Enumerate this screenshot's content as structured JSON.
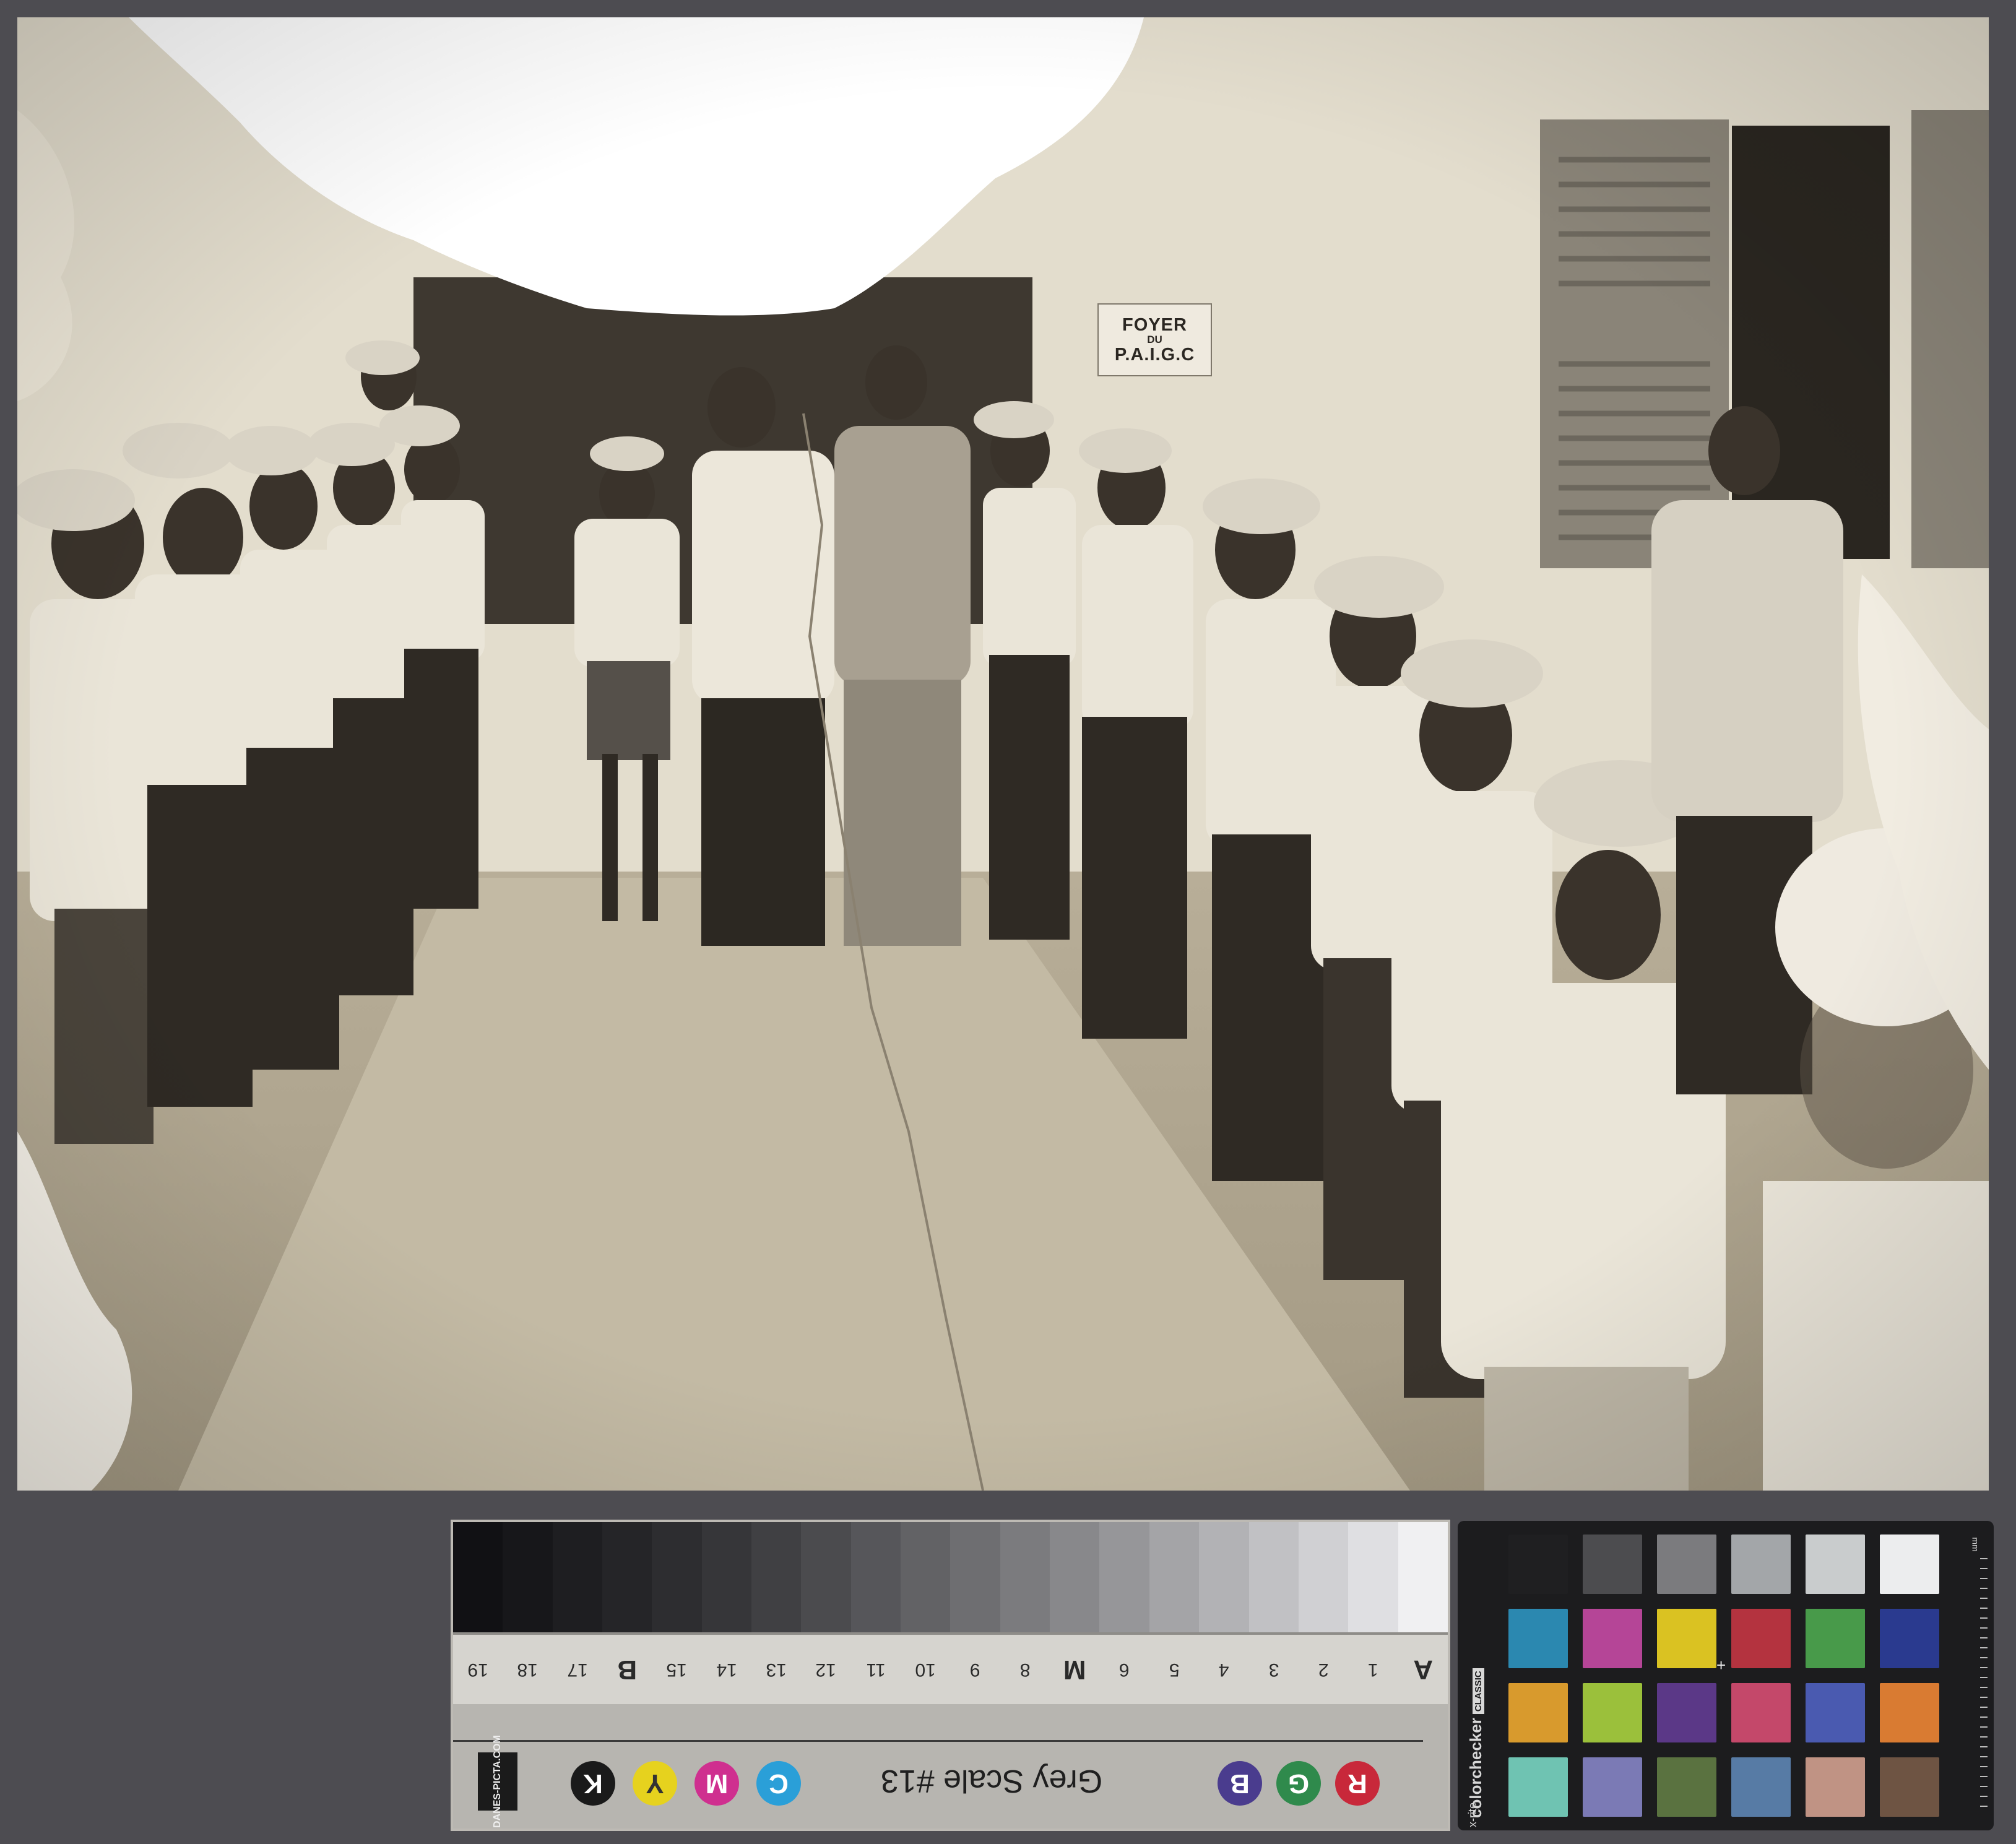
{
  "photo": {
    "sign": {
      "line1": "FOYER",
      "line2": "DU",
      "line3": "P.A.I.G.C"
    }
  },
  "grey_scale": {
    "title": "Grey Scale #13",
    "patch_colors": [
      "#111114",
      "#17171a",
      "#1e1e21",
      "#252528",
      "#2d2d30",
      "#363639",
      "#404043",
      "#4b4b4e",
      "#56565a",
      "#626265",
      "#6e6e71",
      "#7b7b7e",
      "#88888b",
      "#969699",
      "#a4a4a7",
      "#b2b2b5",
      "#c1c1c4",
      "#d0d0d3",
      "#dfdfe2",
      "#f0f0f2"
    ],
    "numbers": [
      "19",
      "18",
      "17",
      "B",
      "15",
      "14",
      "13",
      "12",
      "11",
      "10",
      "9",
      "8",
      "M",
      "6",
      "5",
      "4",
      "3",
      "2",
      "1",
      "A"
    ],
    "rgb_dots": [
      "R",
      "G",
      "B"
    ],
    "cmyk_dots": [
      "K",
      "Y",
      "M",
      "C"
    ],
    "logo_text": "DANES-PICTA.COM"
  },
  "color_checker": {
    "brand": "colorchecker",
    "edition": "CLASSIC",
    "maker": "x-rite",
    "unit": "mm",
    "swatches": [
      "#1f1f21",
      "#4c4c4f",
      "#7b7b7e",
      "#a3a6a9",
      "#c9cccd",
      "#ecedee",
      "#2b88b0",
      "#b54597",
      "#dac222",
      "#b4333f",
      "#489a4a",
      "#2a3a8f",
      "#d89a2d",
      "#9bc03b",
      "#5b3887",
      "#c4486a",
      "#4a5ab0",
      "#d97b32",
      "#6fc3b2",
      "#7b7ab5",
      "#5a7240",
      "#577ba5",
      "#c09384",
      "#6e5443"
    ]
  }
}
